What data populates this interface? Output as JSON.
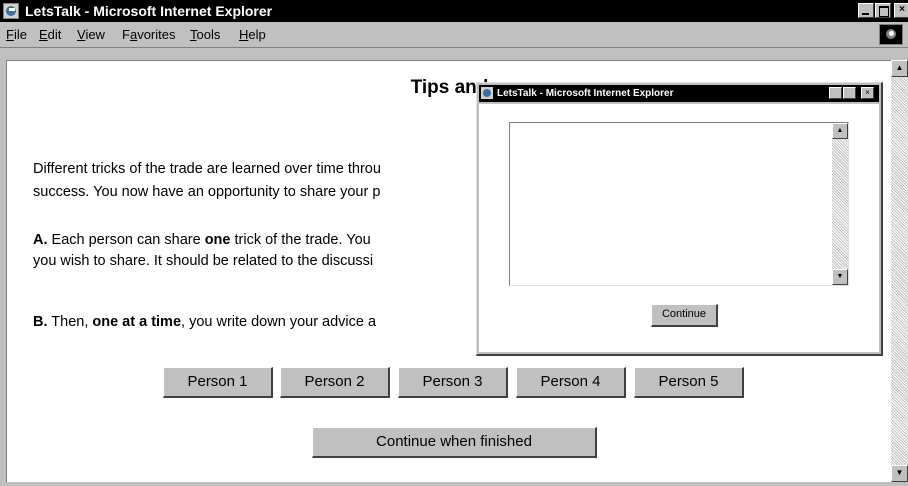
{
  "window": {
    "title": "LetsTalk - Microsoft Internet Explorer",
    "controls": {
      "minimize": "_",
      "maximize": "□",
      "close": "×"
    }
  },
  "menu": {
    "items": [
      {
        "first": "F",
        "rest": "ile"
      },
      {
        "first": "E",
        "rest": "dit"
      },
      {
        "first": "V",
        "rest": "iew"
      },
      {
        "first": "F",
        "rest": "avorites",
        "prefix": ""
      },
      {
        "first": "T",
        "rest": "ools"
      },
      {
        "first": "H",
        "rest": "elp"
      }
    ],
    "favorites_prefix": "F",
    "favorites_underlined": "a",
    "favorites_rest": "vorites"
  },
  "page": {
    "title": "Tips and",
    "p1_line1": "Different tricks of the trade are learned over time throu",
    "p1_line2": "success. You now have an opportunity to share your p",
    "pa_label": "A.",
    "pa_text1": " Each person can share ",
    "pa_bold": "one",
    "pa_text2": " trick of the trade. You",
    "pa_line2": "you wish to share. It should be related to the discussi",
    "pb_label": "B.",
    "pb_text1": " Then, ",
    "pb_bold": "one at a time",
    "pb_text2": ", you write down your advice a",
    "person_buttons": [
      "Person 1",
      "Person 2",
      "Person 3",
      "Person 4",
      "Person 5"
    ],
    "continue_finished": "Continue when finished"
  },
  "popup": {
    "title": "LetsTalk - Microsoft Internet Explorer",
    "textarea_value": "",
    "continue_label": "Continue"
  },
  "icons": {
    "scroll_up": "▲",
    "scroll_down": "▼"
  }
}
